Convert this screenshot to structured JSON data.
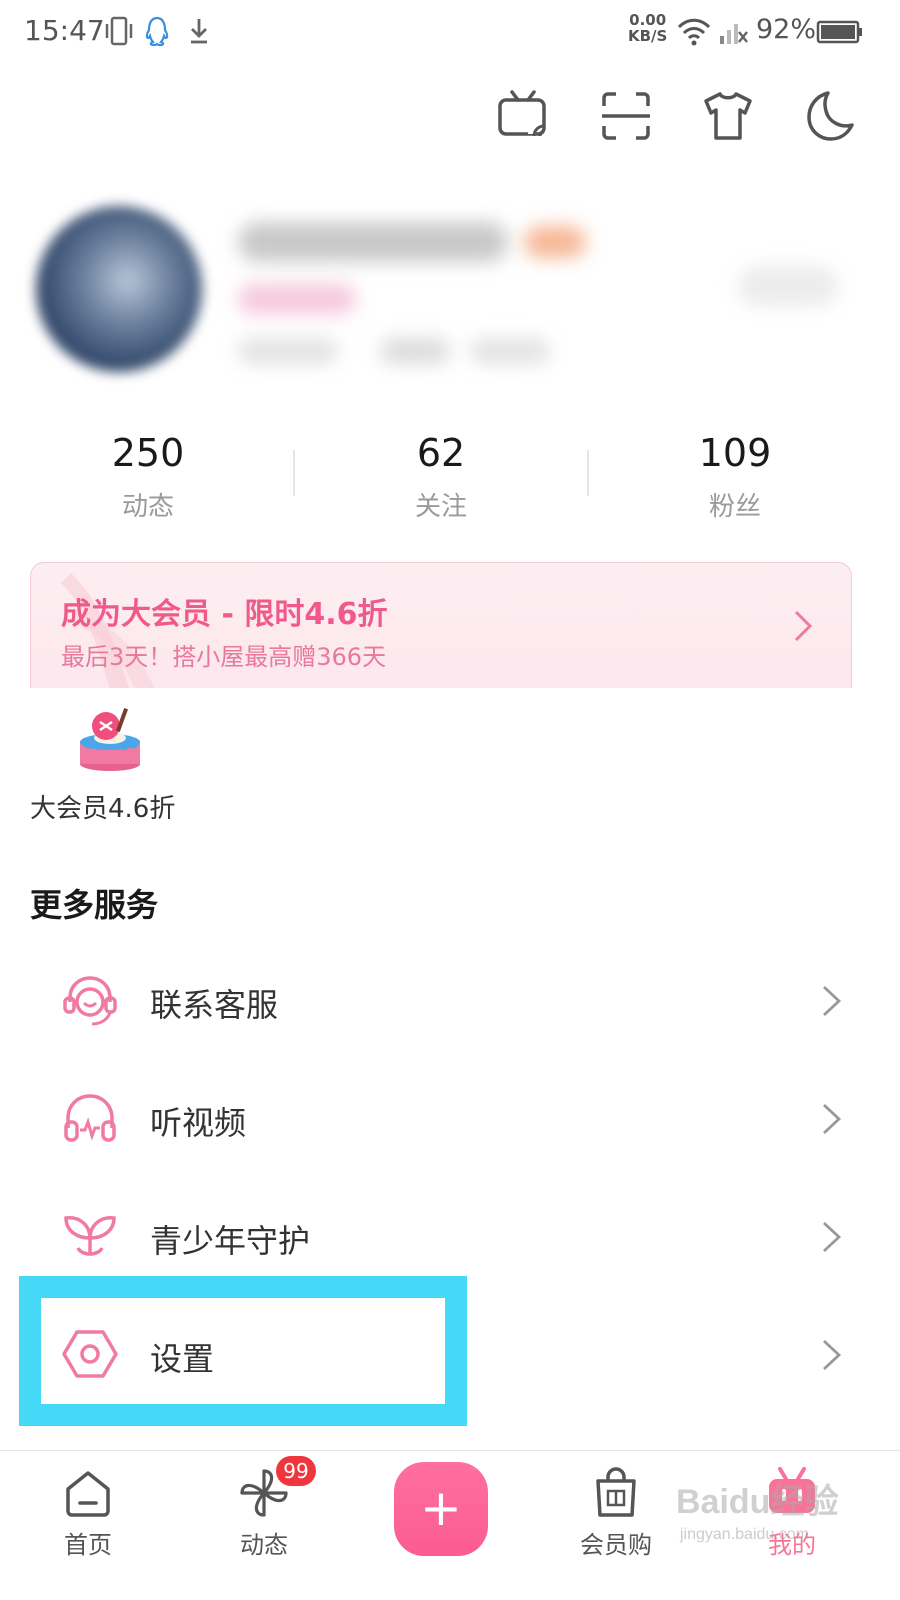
{
  "status_bar": {
    "time": "15:47",
    "speed_value": "0.00",
    "speed_unit": "KB/S",
    "battery": "92%"
  },
  "top_actions": [
    {
      "icon": "tv-cast-icon"
    },
    {
      "icon": "scan-icon"
    },
    {
      "icon": "tshirt-icon"
    },
    {
      "icon": "moon-icon"
    }
  ],
  "stats": [
    {
      "value": "250",
      "label": "动态"
    },
    {
      "value": "62",
      "label": "关注"
    },
    {
      "value": "109",
      "label": "粉丝"
    }
  ],
  "vip_banner": {
    "title": "成为大会员 - 限时4.6折",
    "subtitle": "最后3天！搭小屋最高赠366天"
  },
  "promo": {
    "label": "大会员4.6折"
  },
  "more_services": {
    "title": "更多服务",
    "items": [
      {
        "label": "联系客服",
        "icon": "customer-service-icon"
      },
      {
        "label": "听视频",
        "icon": "headphones-icon"
      },
      {
        "label": "青少年守护",
        "icon": "sprout-icon"
      },
      {
        "label": "设置",
        "icon": "settings-hex-icon"
      }
    ]
  },
  "bottom_nav": {
    "items": [
      {
        "label": "首页",
        "icon": "home-icon"
      },
      {
        "label": "动态",
        "icon": "pinwheel-icon",
        "badge": "99"
      },
      {
        "label": "",
        "icon": "plus-icon"
      },
      {
        "label": "会员购",
        "icon": "shopping-bag-icon"
      },
      {
        "label": "我的",
        "icon": "bilibili-tv-icon",
        "active": true
      }
    ]
  },
  "watermark": {
    "text": "Baidu经验",
    "sub": "jingyan.baidu.com"
  },
  "colors": {
    "accent": "#fb7299",
    "highlight": "#45d8f7",
    "badge": "#f0363d"
  }
}
